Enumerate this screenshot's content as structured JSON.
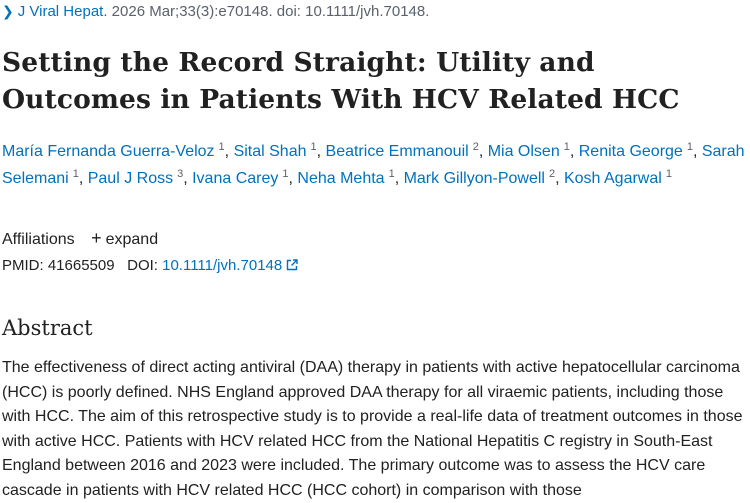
{
  "citation": {
    "journal": "J Viral Hepat.",
    "details": "2026 Mar;33(3):e70148. doi: 10.1111/jvh.70148."
  },
  "title": "Setting the Record Straight: Utility and Outcomes in Patients With HCV Related HCC",
  "authors": [
    {
      "name": "María Fernanda Guerra-Veloz",
      "aff": "1"
    },
    {
      "name": "Sital Shah",
      "aff": "1"
    },
    {
      "name": "Beatrice Emmanouil",
      "aff": "2"
    },
    {
      "name": "Mia Olsen",
      "aff": "1"
    },
    {
      "name": "Renita George",
      "aff": "1"
    },
    {
      "name": "Sarah Selemani",
      "aff": "1"
    },
    {
      "name": "Paul J Ross",
      "aff": "3"
    },
    {
      "name": "Ivana Carey",
      "aff": "1"
    },
    {
      "name": "Neha Mehta",
      "aff": "1"
    },
    {
      "name": "Mark Gillyon-Powell",
      "aff": "2"
    },
    {
      "name": "Kosh Agarwal",
      "aff": "1"
    }
  ],
  "affiliations": {
    "label": "Affiliations",
    "expand": "expand"
  },
  "ids": {
    "pmid_label": "PMID:",
    "pmid": "41665509",
    "doi_label": "DOI:",
    "doi": "10.1111/jvh.70148"
  },
  "abstract": {
    "heading": "Abstract",
    "text": "The effectiveness of direct acting antiviral (DAA) therapy in patients with active hepatocellular carcinoma (HCC) is poorly defined. NHS England approved DAA therapy for all viraemic patients, including those with HCC. The aim of this retrospective study is to provide a real-life data of treatment outcomes in those with active HCC. Patients with HCV related HCC from the National Hepatitis C registry in South-East England between 2016 and 2023 were included. The primary outcome was to assess the HCV care cascade in patients with HCV related HCC (HCC cohort) in comparison with those"
  }
}
